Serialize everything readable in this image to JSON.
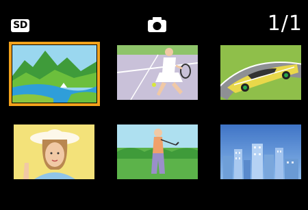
{
  "header": {
    "storage_badge": "SD",
    "mode_icon": "camera-icon",
    "page_counter": "1/1"
  },
  "colors": {
    "background": "#000000",
    "selection": "#f2a21c"
  },
  "thumbnails": [
    {
      "subject": "landscape",
      "selected": true
    },
    {
      "subject": "tennis-player",
      "selected": false
    },
    {
      "subject": "sports-car",
      "selected": false
    },
    {
      "subject": "portrait-woman-hat",
      "selected": false
    },
    {
      "subject": "golfer",
      "selected": false
    },
    {
      "subject": "city-skyline",
      "selected": false
    }
  ]
}
